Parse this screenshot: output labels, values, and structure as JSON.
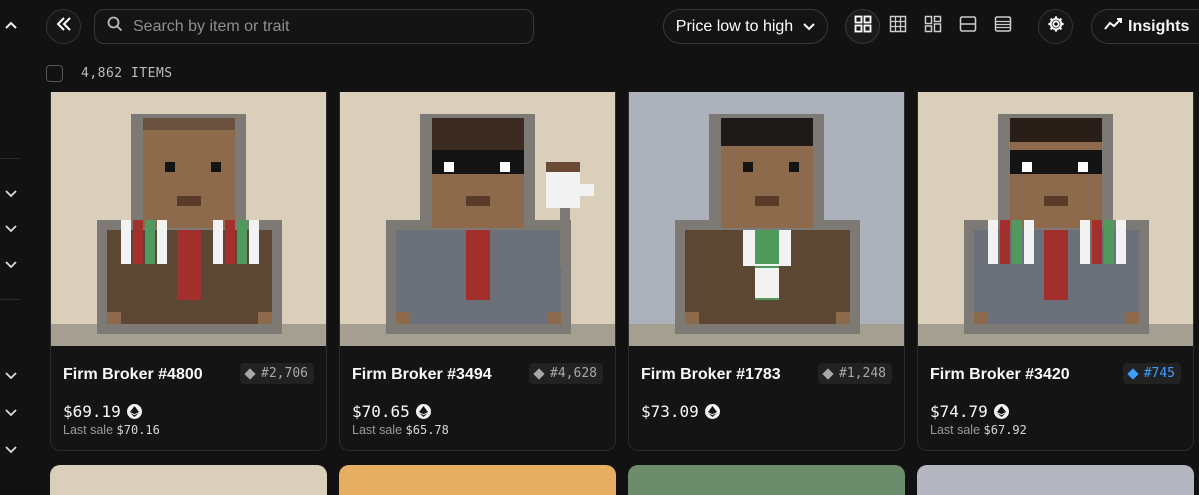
{
  "search": {
    "placeholder": "Search by item or trait"
  },
  "sort": {
    "label": "Price low to high"
  },
  "insights": {
    "label": "Insights"
  },
  "collection": {
    "count_label": "4,862 ITEMS"
  },
  "cards": [
    {
      "name": "Firm Broker #4800",
      "rank": "#2,706",
      "rank_color": "#a8a8a8",
      "price": "$69.19",
      "last_sale_label": "Last sale",
      "last_sale": "$70.16",
      "bg": "#d9cfba"
    },
    {
      "name": "Firm Broker #3494",
      "rank": "#4,628",
      "rank_color": "#a8a8a8",
      "price": "$70.65",
      "last_sale_label": "Last sale",
      "last_sale": "$65.78",
      "bg": "#d9cfba"
    },
    {
      "name": "Firm Broker #1783",
      "rank": "#1,248",
      "rank_color": "#a8a8a8",
      "price": "$73.09",
      "last_sale_label": "",
      "last_sale": "",
      "bg": "#adb1b9"
    },
    {
      "name": "Firm Broker #3420",
      "rank": "#745",
      "rank_color": "#3f9bff",
      "price": "$74.79",
      "last_sale_label": "Last sale",
      "last_sale": "$67.92",
      "bg": "#d9cfba"
    }
  ],
  "next_row_colors": [
    "#d9cfba",
    "#e5ae62",
    "#6b8d6c",
    "#b4b7bf"
  ],
  "icons": {
    "toolbar": [
      "collapse-left-icon",
      "search-icon",
      "chevron-down-icon",
      "grid-large-icon",
      "grid-small-icon",
      "grid-mosaic-icon",
      "list-icon",
      "table-icon",
      "gear-icon",
      "chart-line-icon"
    ],
    "price": "ethereum-icon",
    "rail": [
      "chevron-up-icon",
      "chevron-down-icon"
    ]
  }
}
